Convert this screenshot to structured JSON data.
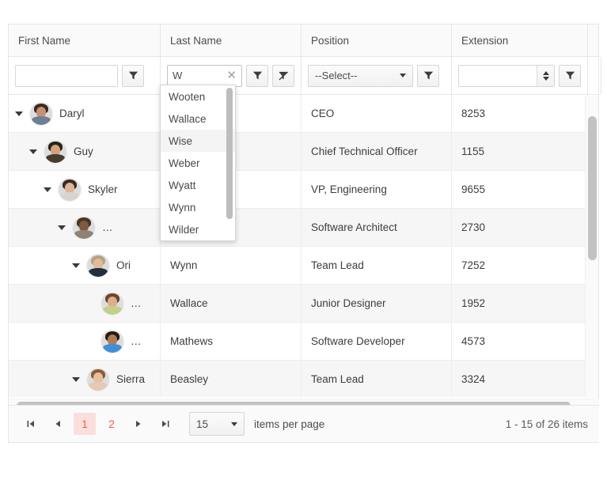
{
  "grid": {
    "columns": [
      {
        "label": "First Name",
        "key": "first_name"
      },
      {
        "label": "Last Name",
        "key": "last_name"
      },
      {
        "label": "Position",
        "key": "position"
      },
      {
        "label": "Extension",
        "key": "extension"
      }
    ],
    "filters": {
      "first_name": {
        "type": "text",
        "value": "",
        "placeholder": ""
      },
      "last_name": {
        "type": "autocomplete",
        "value": "W",
        "clear_icon": "close-icon",
        "extra_button": "clear-filter-icon"
      },
      "position": {
        "type": "select",
        "value": "--Select--"
      },
      "extension": {
        "type": "numeric",
        "value": "",
        "spinner": true
      }
    },
    "filter_button_icon": "filter-icon",
    "clear_filter_button_icon": "clear-filter-icon",
    "rows": [
      {
        "level": 0,
        "expanded": true,
        "has_children": true,
        "first_name": "Daryl",
        "last_name": "",
        "position": "CEO",
        "extension": "8253",
        "avatar": "avatar-daryl",
        "hair": "#3a2b20",
        "skin": "#c79272",
        "body": "#6d7f93"
      },
      {
        "level": 1,
        "expanded": true,
        "has_children": true,
        "first_name": "Guy",
        "last_name": "",
        "position": "Chief Technical Officer",
        "extension": "1155",
        "avatar": "avatar-guy",
        "hair": "#2b2118",
        "skin": "#d3a37e",
        "body": "#473c2e"
      },
      {
        "level": 2,
        "expanded": true,
        "has_children": true,
        "first_name": "Skyler",
        "last_name": "",
        "position": "VP, Engineering",
        "extension": "9655",
        "avatar": "avatar-skyler",
        "hair": "#3b2a22",
        "skin": "#e0b495",
        "body": "#d8d4d0"
      },
      {
        "level": 3,
        "expanded": true,
        "has_children": true,
        "first_name": "…",
        "last_name": "",
        "position": "Software Architect",
        "extension": "2730",
        "avatar": "avatar-unnamed-1",
        "hair": "#4a3423",
        "skin": "#7d5a40",
        "body": "#8d8274"
      },
      {
        "level": 4,
        "expanded": true,
        "has_children": true,
        "first_name": "Ori",
        "last_name": "Wynn",
        "position": "Team Lead",
        "extension": "7252",
        "avatar": "avatar-ori",
        "hair": "#b9a283",
        "skin": "#e2bb9a",
        "body": "#22303f"
      },
      {
        "level": 5,
        "expanded": false,
        "has_children": false,
        "first_name": "…",
        "last_name": "Wallace",
        "position": "Junior Designer",
        "extension": "1952",
        "avatar": "avatar-unnamed-2",
        "hair": "#6d4530",
        "skin": "#dcae8c",
        "body": "#c2d08a"
      },
      {
        "level": 5,
        "expanded": false,
        "has_children": false,
        "first_name": "…",
        "last_name": "Mathews",
        "position": "Software Developer",
        "extension": "4573",
        "avatar": "avatar-unnamed-3",
        "hair": "#271c13",
        "skin": "#b07c55",
        "body": "#3f8fd8"
      },
      {
        "level": 4,
        "expanded": true,
        "has_children": true,
        "first_name": "Sierra",
        "last_name": "Beasley",
        "position": "Team Lead",
        "extension": "3324",
        "avatar": "avatar-sierra",
        "hair": "#8a5c3a",
        "skin": "#e8c0a0",
        "body": "#e3c9b6"
      }
    ]
  },
  "autocomplete_popup": {
    "visible": true,
    "items": [
      {
        "label": "Wooten",
        "selected": false
      },
      {
        "label": "Wallace",
        "selected": false
      },
      {
        "label": "Wise",
        "selected": true
      },
      {
        "label": "Weber",
        "selected": false
      },
      {
        "label": "Wyatt",
        "selected": false
      },
      {
        "label": "Wynn",
        "selected": false
      },
      {
        "label": "Wilder",
        "selected": false
      }
    ]
  },
  "pager": {
    "first_icon": "go-to-first-page-icon",
    "prev_icon": "previous-page-icon",
    "next_icon": "next-page-icon",
    "last_icon": "go-to-last-page-icon",
    "pages": [
      {
        "label": "1",
        "active": true
      },
      {
        "label": "2",
        "active": false
      }
    ],
    "page_size": "15",
    "page_size_label": "items per page",
    "info": "1 - 15 of 26 items"
  },
  "colors": {
    "accent": "#f4603e",
    "accent_bg": "#fbdfdc",
    "border": "#e6e6e6",
    "row_alt": "#f6f6f6",
    "header_bg": "#fafafa",
    "scrollbar": "#c2c2c2"
  }
}
